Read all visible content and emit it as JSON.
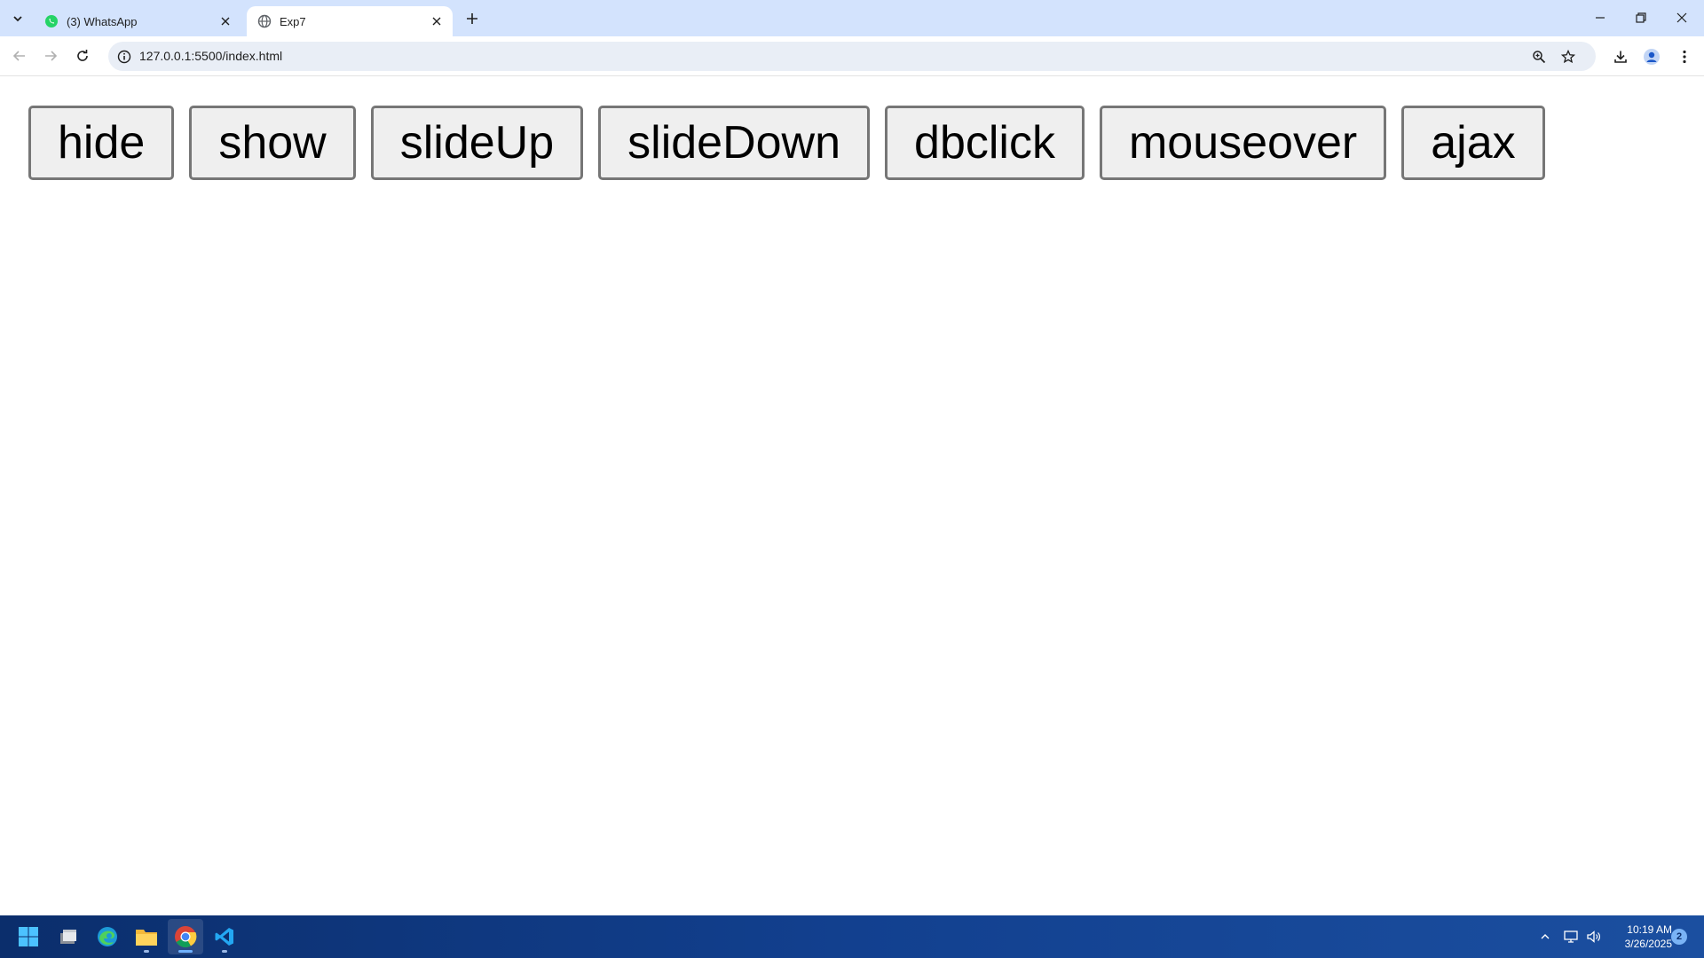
{
  "browser": {
    "tabs": [
      {
        "title": "(3) WhatsApp",
        "icon": "whatsapp-icon",
        "active": false
      },
      {
        "title": "Exp7",
        "icon": "globe-icon",
        "active": true
      }
    ],
    "address": "127.0.0.1:5500/index.html"
  },
  "page": {
    "buttons": [
      {
        "label": "hide"
      },
      {
        "label": "show"
      },
      {
        "label": "slideUp"
      },
      {
        "label": "slideDown"
      },
      {
        "label": "dbclick"
      },
      {
        "label": "mouseover"
      },
      {
        "label": "ajax"
      }
    ]
  },
  "taskbar": {
    "time": "10:19 AM",
    "date": "3/26/2025",
    "notification_count": "2",
    "apps": [
      "windows-start-icon",
      "file-manager-icon",
      "edge-icon",
      "file-explorer-icon",
      "chrome-icon",
      "vscode-icon"
    ]
  },
  "colors": {
    "tabstrip_bg": "#d3e3fd",
    "omnibox_bg": "#e9eef6",
    "button_bg": "#efefef",
    "button_border": "#767676",
    "taskbar_bg": "#12408f"
  }
}
